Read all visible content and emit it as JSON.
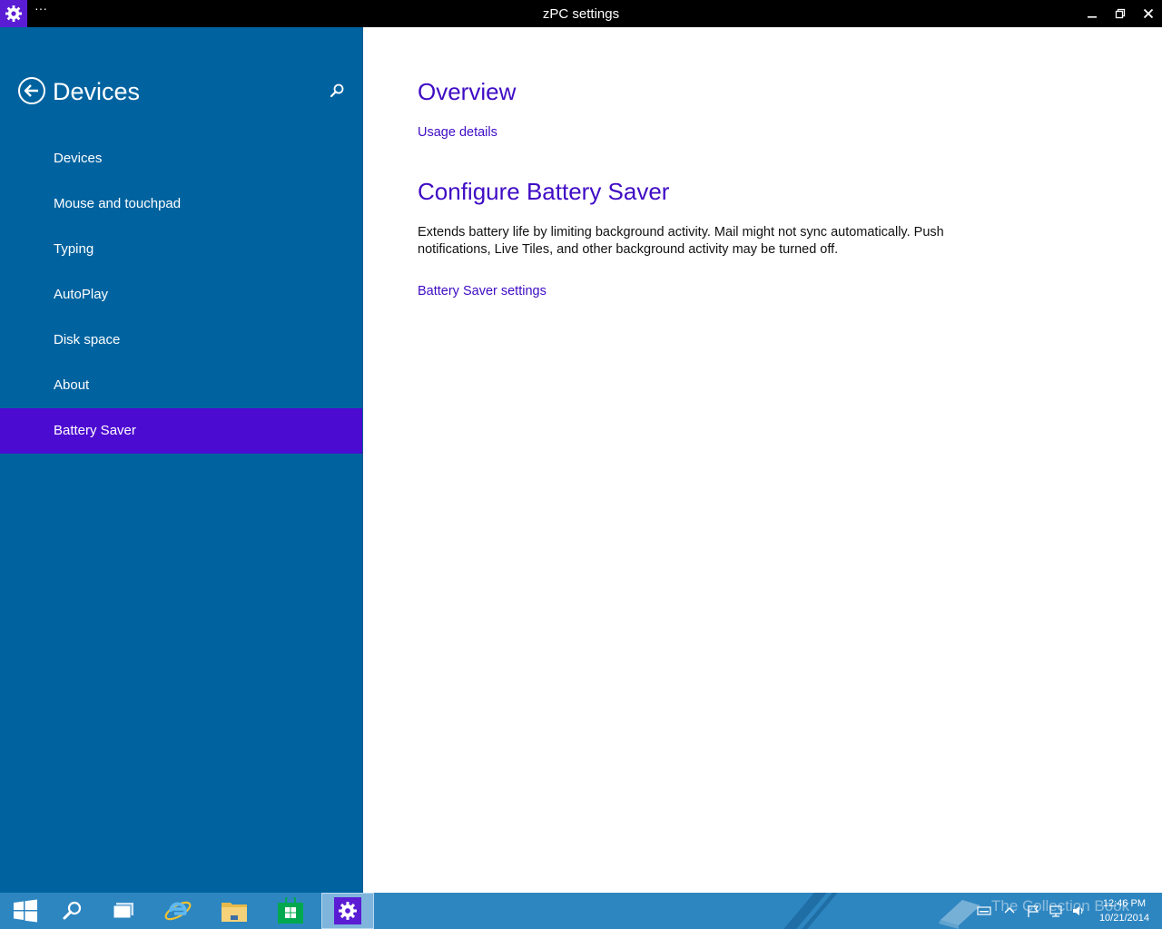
{
  "window": {
    "title": "zPC settings",
    "menu_glyph": "···",
    "app_icon": "gear-icon",
    "controls": [
      "minimize-icon",
      "restore-icon",
      "close-icon"
    ]
  },
  "sidebar": {
    "title": "Devices",
    "back_icon": "back-arrow-icon",
    "search_icon": "search-icon",
    "items": [
      {
        "label": "Devices"
      },
      {
        "label": "Mouse and touchpad"
      },
      {
        "label": "Typing"
      },
      {
        "label": "AutoPlay"
      },
      {
        "label": "Disk space"
      },
      {
        "label": "About"
      },
      {
        "label": "Battery Saver",
        "selected": true
      }
    ]
  },
  "main": {
    "overview_heading": "Overview",
    "usage_link": "Usage details",
    "configure_heading": "Configure Battery Saver",
    "description": "Extends battery life by limiting background activity. Mail might not sync automatically. Push notifications, Live Tiles, and other background activity may be turned off.",
    "settings_link": "Battery Saver settings"
  },
  "taskbar": {
    "apps": [
      "start-icon",
      "search-icon",
      "task-view-icon",
      "internet-explorer-icon",
      "file-explorer-icon",
      "store-icon",
      "settings-icon"
    ],
    "watermark": "The Collection Book",
    "time": "12:46 PM",
    "date": "10/21/2014"
  },
  "colors": {
    "sidebar": "#0063a0",
    "selected_item": "#4c0bd0",
    "accent_text": "#3f0bc5",
    "titlebar": "#000000",
    "taskbar": "#2e86c1"
  }
}
